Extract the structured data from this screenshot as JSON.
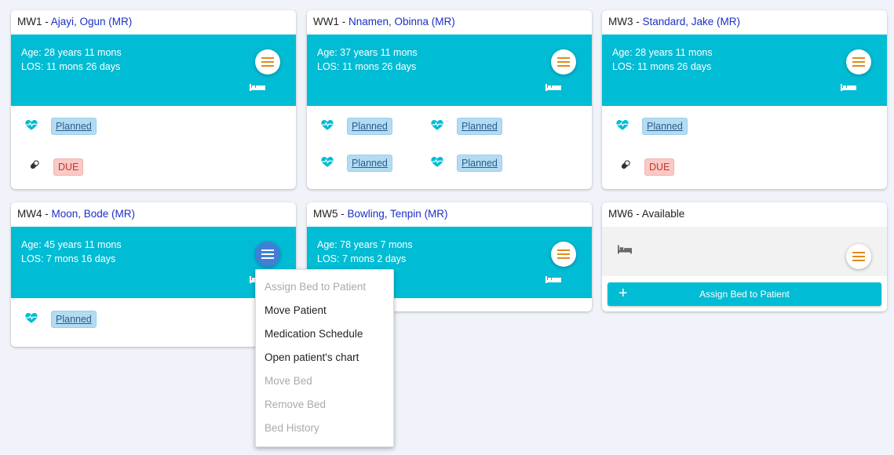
{
  "colors": {
    "accent": "#00bcd4",
    "patient_link": "#1a2fc7",
    "menu_icon": "#e08a1e",
    "menu_active": "#3f7fd8"
  },
  "cards": [
    {
      "bed": "MW1",
      "sep": " - ",
      "patient": "Ajayi, Ogun (MR)",
      "age": "Age: 28 years 11 mons",
      "los": "LOS: 11 mons 26 days",
      "tags": [
        {
          "icon": "heart-pulse-icon",
          "label": "Planned"
        },
        {
          "icon": "pill-icon",
          "label": "DUE"
        }
      ]
    },
    {
      "bed": "WW1",
      "sep": " - ",
      "patient": "Nnamen, Obinna (MR)",
      "age": "Age: 37 years 11 mons",
      "los": "LOS: 11 mons 26 days",
      "tags": [
        {
          "icon": "heart-pulse-icon",
          "label": "Planned"
        },
        {
          "icon": "heart-pulse-icon",
          "label": "Planned"
        },
        {
          "icon": "heart-pulse-icon",
          "label": "Planned"
        },
        {
          "icon": "heart-pulse-icon",
          "label": "Planned"
        }
      ]
    },
    {
      "bed": "MW3",
      "sep": " - ",
      "patient": "Standard, Jake (MR)",
      "age": "Age: 28 years 11 mons",
      "los": "LOS: 11 mons 26 days",
      "tags": [
        {
          "icon": "heart-pulse-icon",
          "label": "Planned"
        },
        {
          "icon": "pill-icon",
          "label": "DUE"
        }
      ]
    },
    {
      "bed": "MW4",
      "sep": " - ",
      "patient": "Moon, Bode (MR)",
      "age": "Age: 45 years 11 mons",
      "los": "LOS: 7 mons 16 days",
      "tags": [
        {
          "icon": "heart-pulse-icon",
          "label": "Planned"
        }
      ]
    },
    {
      "bed": "MW5",
      "sep": " - ",
      "patient": "Bowling, Tenpin (MR)",
      "age": "Age: 78 years 7 mons",
      "los": "LOS: 7 mons 2 days",
      "tags": []
    },
    {
      "bed": "MW6",
      "sep": " - ",
      "status": "Available",
      "assign_label": "Assign Bed to Patient"
    }
  ],
  "context_menu": {
    "items": [
      {
        "label": "Assign Bed to Patient",
        "enabled": false
      },
      {
        "label": "Move Patient",
        "enabled": true
      },
      {
        "label": "Medication Schedule",
        "enabled": true
      },
      {
        "label": "Open patient's chart",
        "enabled": true
      },
      {
        "label": "Move Bed",
        "enabled": false
      },
      {
        "label": "Remove Bed",
        "enabled": false
      },
      {
        "label": "Bed History",
        "enabled": false
      }
    ]
  }
}
